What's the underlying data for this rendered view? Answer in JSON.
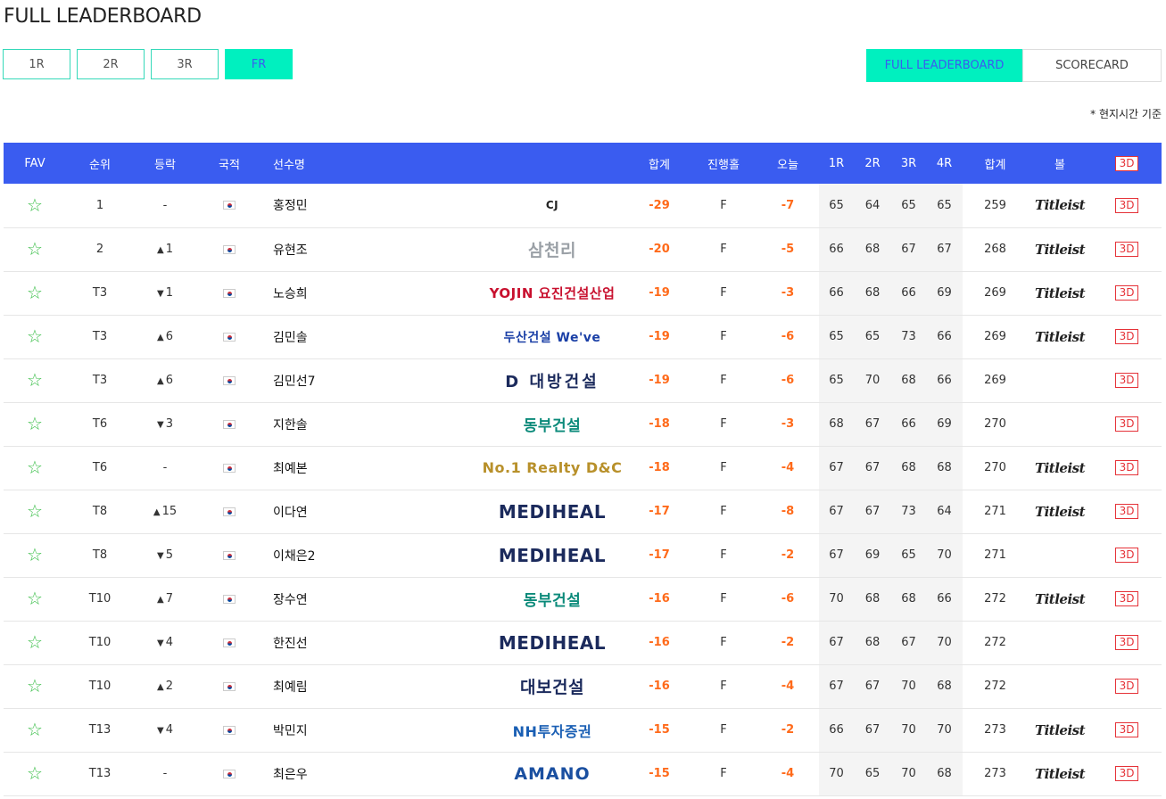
{
  "page": {
    "title": "FULL LEADERBOARD"
  },
  "round_tabs": [
    {
      "label": "1R",
      "active": false
    },
    {
      "label": "2R",
      "active": false
    },
    {
      "label": "3R",
      "active": false
    },
    {
      "label": "FR",
      "active": true
    }
  ],
  "view_tabs": {
    "leaderboard": "FULL LEADERBOARD",
    "scorecard": "SCORECARD"
  },
  "time_note": "* 현지시간 기준",
  "colors": {
    "header_bg": "#3a5cf0",
    "accent": "#00f0bf",
    "score": "#ff6a1a",
    "up": "#e53238",
    "down": "#2b4fd6",
    "star": "#3cbf4a"
  },
  "table": {
    "headers": {
      "fav": "FAV",
      "rank": "순위",
      "move": "등락",
      "nation": "국적",
      "name": "선수명",
      "total": "합계",
      "thru": "진행홀",
      "today": "오늘",
      "r1": "1R",
      "r2": "2R",
      "r3": "3R",
      "r4": "4R",
      "strokes": "합계",
      "ball": "볼",
      "view3d": "3D"
    },
    "rows": [
      {
        "rank": "1",
        "move": "-",
        "move_dir": "none",
        "name": "홍정민",
        "sponsor": "CJ",
        "total": "-29",
        "thru": "F",
        "today": "-7",
        "r1": "65",
        "r2": "64",
        "r3": "65",
        "r4": "65",
        "strokes": "259",
        "ball": "Titleist",
        "view3d": "3D"
      },
      {
        "rank": "2",
        "move": "1",
        "move_dir": "up",
        "name": "유현조",
        "sponsor": "삼천리",
        "total": "-20",
        "thru": "F",
        "today": "-5",
        "r1": "66",
        "r2": "68",
        "r3": "67",
        "r4": "67",
        "strokes": "268",
        "ball": "Titleist",
        "view3d": "3D"
      },
      {
        "rank": "T3",
        "move": "1",
        "move_dir": "down",
        "name": "노승희",
        "sponsor": "YOJIN 요진건설산업",
        "total": "-19",
        "thru": "F",
        "today": "-3",
        "r1": "66",
        "r2": "68",
        "r3": "66",
        "r4": "69",
        "strokes": "269",
        "ball": "Titleist",
        "view3d": "3D"
      },
      {
        "rank": "T3",
        "move": "6",
        "move_dir": "up",
        "name": "김민솔",
        "sponsor": "두산건설 We've",
        "total": "-19",
        "thru": "F",
        "today": "-6",
        "r1": "65",
        "r2": "65",
        "r3": "73",
        "r4": "66",
        "strokes": "269",
        "ball": "Titleist",
        "view3d": "3D"
      },
      {
        "rank": "T3",
        "move": "6",
        "move_dir": "up",
        "name": "김민선7",
        "sponsor": "D 대방건설",
        "total": "-19",
        "thru": "F",
        "today": "-6",
        "r1": "65",
        "r2": "70",
        "r3": "68",
        "r4": "66",
        "strokes": "269",
        "ball": "",
        "view3d": "3D"
      },
      {
        "rank": "T6",
        "move": "3",
        "move_dir": "down",
        "name": "지한솔",
        "sponsor": "동부건설",
        "total": "-18",
        "thru": "F",
        "today": "-3",
        "r1": "68",
        "r2": "67",
        "r3": "66",
        "r4": "69",
        "strokes": "270",
        "ball": "",
        "view3d": "3D"
      },
      {
        "rank": "T6",
        "move": "-",
        "move_dir": "none",
        "name": "최예본",
        "sponsor": "No.1 Realty D&C",
        "total": "-18",
        "thru": "F",
        "today": "-4",
        "r1": "67",
        "r2": "67",
        "r3": "68",
        "r4": "68",
        "strokes": "270",
        "ball": "Titleist",
        "view3d": "3D"
      },
      {
        "rank": "T8",
        "move": "15",
        "move_dir": "up",
        "name": "이다연",
        "sponsor": "MEDIHEAL",
        "total": "-17",
        "thru": "F",
        "today": "-8",
        "r1": "67",
        "r2": "67",
        "r3": "73",
        "r4": "64",
        "strokes": "271",
        "ball": "Titleist",
        "view3d": "3D"
      },
      {
        "rank": "T8",
        "move": "5",
        "move_dir": "down",
        "name": "이채은2",
        "sponsor": "MEDIHEAL",
        "total": "-17",
        "thru": "F",
        "today": "-2",
        "r1": "67",
        "r2": "69",
        "r3": "65",
        "r4": "70",
        "strokes": "271",
        "ball": "",
        "view3d": "3D"
      },
      {
        "rank": "T10",
        "move": "7",
        "move_dir": "up",
        "name": "장수연",
        "sponsor": "동부건설",
        "total": "-16",
        "thru": "F",
        "today": "-6",
        "r1": "70",
        "r2": "68",
        "r3": "68",
        "r4": "66",
        "strokes": "272",
        "ball": "Titleist",
        "view3d": "3D"
      },
      {
        "rank": "T10",
        "move": "4",
        "move_dir": "down",
        "name": "한진선",
        "sponsor": "MEDIHEAL",
        "total": "-16",
        "thru": "F",
        "today": "-2",
        "r1": "67",
        "r2": "68",
        "r3": "67",
        "r4": "70",
        "strokes": "272",
        "ball": "",
        "view3d": "3D"
      },
      {
        "rank": "T10",
        "move": "2",
        "move_dir": "up",
        "name": "최예림",
        "sponsor": "대보건설",
        "total": "-16",
        "thru": "F",
        "today": "-4",
        "r1": "67",
        "r2": "67",
        "r3": "70",
        "r4": "68",
        "strokes": "272",
        "ball": "",
        "view3d": "3D"
      },
      {
        "rank": "T13",
        "move": "4",
        "move_dir": "down",
        "name": "박민지",
        "sponsor": "NH투자증권",
        "total": "-15",
        "thru": "F",
        "today": "-2",
        "r1": "66",
        "r2": "67",
        "r3": "70",
        "r4": "70",
        "strokes": "273",
        "ball": "Titleist",
        "view3d": "3D"
      },
      {
        "rank": "T13",
        "move": "-",
        "move_dir": "none",
        "name": "최은우",
        "sponsor": "AMANO",
        "total": "-15",
        "thru": "F",
        "today": "-4",
        "r1": "70",
        "r2": "65",
        "r3": "70",
        "r4": "68",
        "strokes": "273",
        "ball": "Titleist",
        "view3d": "3D"
      }
    ]
  }
}
